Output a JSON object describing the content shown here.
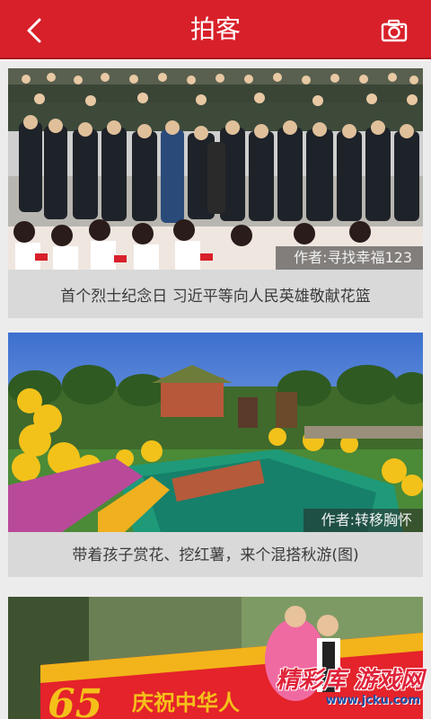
{
  "header": {
    "title": "拍客",
    "back_icon": "back-arrow-icon",
    "camera_icon": "camera-icon",
    "background": "#d8202a"
  },
  "feed": {
    "items": [
      {
        "author": "作者:寻找幸福123",
        "caption": "首个烈士纪念日 习近平等向人民英雄敬献花篮"
      },
      {
        "author": "作者:转移胸怀",
        "caption": "带着孩子赏花、挖红薯，来个混搭秋游(图)"
      },
      {
        "banner_text": "庆祝中华人",
        "banner_number": "65"
      }
    ]
  },
  "watermark": {
    "title": "精彩库 游戏网",
    "url": "www.jcku.com"
  }
}
